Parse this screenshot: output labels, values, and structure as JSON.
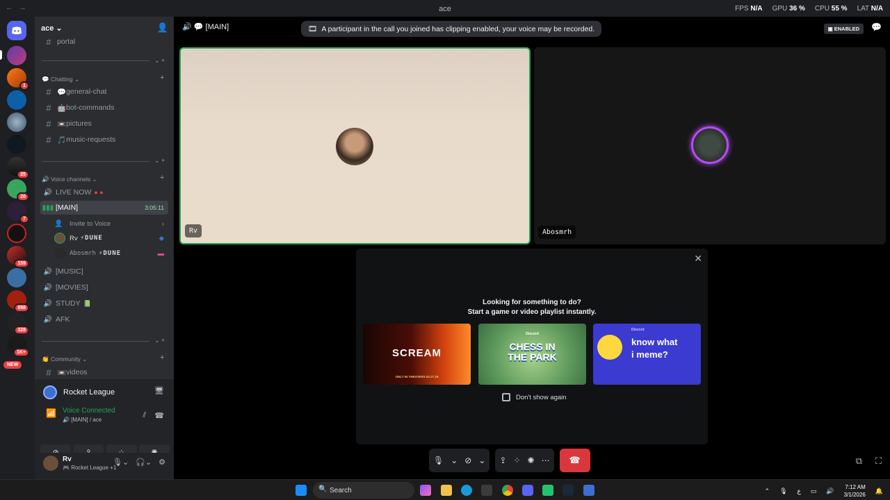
{
  "titlebar": {
    "title": "ace",
    "fps_label": "FPS",
    "fps_value": "N/A",
    "gpu_label": "GPU",
    "gpu_value": "36 %",
    "cpu_label": "CPU",
    "cpu_value": "55 %",
    "lat_label": "LAT",
    "lat_value": "N/A"
  },
  "rail": {
    "badges": [
      "1",
      "25",
      "20",
      "7",
      "159",
      "888",
      "328",
      "1K+"
    ],
    "new_label": "NEW"
  },
  "guild": {
    "name": "ace"
  },
  "channels": {
    "top_partial": "portal",
    "chatting_category": "Chatting",
    "text": [
      {
        "emoji": "💬",
        "name": "general-chat"
      },
      {
        "emoji": "🤖",
        "name": "bot-commands"
      },
      {
        "emoji": "📼",
        "name": "pictures"
      },
      {
        "emoji": "🎵",
        "name": "music-requests"
      }
    ],
    "voice_category": "Voice channels",
    "voice_live": "LIVE NOW",
    "voice_main": "[MAIN]",
    "voice_timer": "3:05:11",
    "invite_label": "Invite to Voice",
    "voice_users": [
      {
        "name": "Rv",
        "tag": "DUNE"
      },
      {
        "name": "Abosmrh",
        "tag": "DUNE"
      }
    ],
    "voice_others": [
      "[MUSIC]",
      "[MOVIES]",
      "STUDY",
      "AFK"
    ],
    "community_category": "Community",
    "community_first": "videos"
  },
  "activity": {
    "game": "Rocket League",
    "voice_status": "Voice Connected",
    "voice_location": "[MAIN] / ace"
  },
  "user": {
    "name": "Rv",
    "status": "Rocket League +1"
  },
  "main": {
    "header": "[MAIN]",
    "notice": "A participant in the call you joined has clipping enabled, your voice may be recorded.",
    "enabled_badge": "ENABLED",
    "tile1_name": "Rv",
    "tile2_name": "Abosmrh"
  },
  "activity_modal": {
    "line1": "Looking for something to do?",
    "line2": "Start a game or video playlist instantly.",
    "cards": [
      {
        "title": "SCREAM",
        "subtitle": "ONLY IN THEATERS 02.27.26"
      },
      {
        "title": "CHESS IN THE PARK",
        "subtitle": "Discord"
      },
      {
        "title": "know what i meme?",
        "subtitle": "Discord"
      }
    ],
    "dont_show": "Don't show again"
  },
  "taskbar": {
    "search_placeholder": "Search",
    "time": "7:12 AM",
    "date": "3/1/2026"
  },
  "colors": {
    "green": "#23a55a",
    "red": "#da373c",
    "blurple": "#5865f2"
  }
}
